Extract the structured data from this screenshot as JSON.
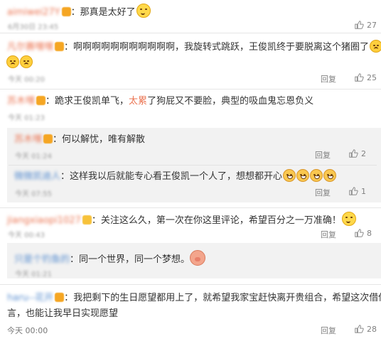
{
  "comments": [
    {
      "username": "aimiwei27Y",
      "text": "那真是太好了",
      "time": "6月30日 23:45",
      "likes": "27"
    },
    {
      "username": "凡尔赛嘿嘿",
      "text_line1": "啊啊啊啊啊啊啊啊啊啊啊，我旋转式跳跃，王俊凯终于要脱离这个猪圈了",
      "time": "今天 00:20",
      "reply_label": "回复",
      "likes": "25"
    },
    {
      "username": "苏木嘿",
      "text_pre": "跪求王俊凯单飞，",
      "text_link": "太累",
      "text_post": "了狗屁又不要脸，典型的吸血鬼忘恩负义",
      "time": "今天 01:23"
    },
    {
      "username": "苏木嘿",
      "text": "何以解忧，唯有解散",
      "time": "今天 01:24",
      "reply_label": "回复",
      "likes": "2",
      "is_reply": true
    },
    {
      "username": "微微凯迪人",
      "text": "这样我以后就能专心看王俊凯一个人了，想想都开心",
      "time": "今天 07:55",
      "reply_label": "回复",
      "likes": "1",
      "is_reply": true
    },
    {
      "username": "jiangxiaopi1027",
      "text": "关注这么久，第一次在你这里评论，希望百分之一万准确！",
      "time": "今天 00:43",
      "reply_label": "回复",
      "likes": "8"
    },
    {
      "username": "只是个钓鱼的",
      "text": "同一个世界，同一个梦想。",
      "time": "今天 01:21",
      "is_reply": true
    },
    {
      "username": "haru--花开",
      "text_line1": "我把剩下的生日愿望都用上了，就希望我家宝赶快离开贵组合，希望这次借你吉",
      "text_line2": "言，也能让我早日实现愿望",
      "time": "今天 00:00",
      "reply_label": "回复",
      "likes": "28"
    }
  ],
  "colors": {
    "username": "#eb7350",
    "text": "#333333",
    "meta": "#808080",
    "reply_bg": "#f2f2f2"
  },
  "icons": {
    "like": "thumbs-up-icon",
    "smile": "smile-emoji-icon",
    "cry": "cry-emoji-icon",
    "grin": "grin-emoji-icon",
    "pig": "pig-emoji-icon"
  }
}
